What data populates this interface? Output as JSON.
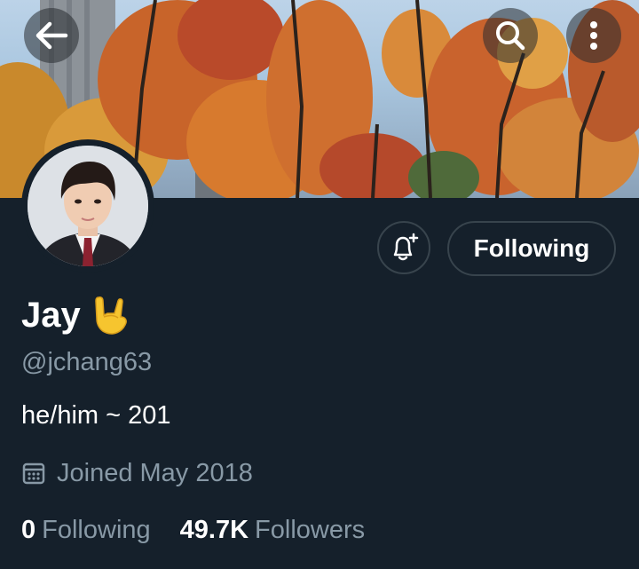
{
  "header": {
    "back_icon": "arrow-left-icon",
    "search_icon": "search-icon",
    "more_icon": "more-vertical-icon"
  },
  "profile": {
    "name": "Jay",
    "name_emoji": "🤟",
    "handle": "@jchang63",
    "bio": "he/him ~ 201",
    "joined": "Joined May 2018",
    "joined_icon": "calendar-icon"
  },
  "actions": {
    "notify_icon": "bell-plus-icon",
    "following_label": "Following"
  },
  "stats": {
    "following_count": "0",
    "following_label": "Following",
    "followers_count": "49.7K",
    "followers_label": "Followers"
  },
  "colors": {
    "background": "#15202b",
    "muted_text": "#8899a6",
    "border": "#38444d"
  }
}
